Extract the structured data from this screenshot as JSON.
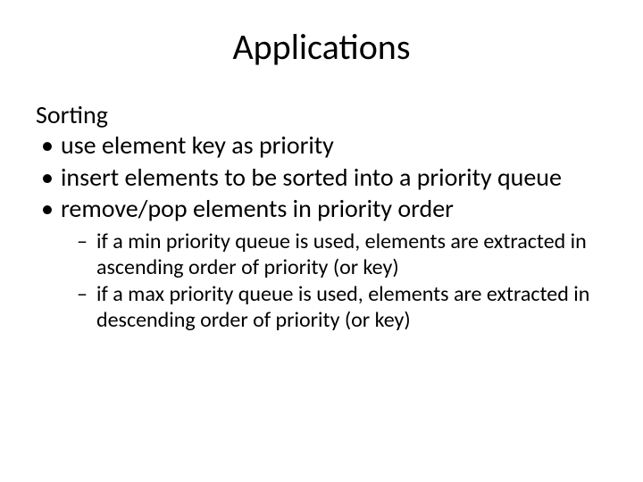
{
  "title": "Applications",
  "section": "Sorting",
  "bullets": [
    "use element key as priority",
    "insert elements to be sorted into a priority queue",
    "remove/pop elements in priority order"
  ],
  "sub_bullets": [
    "if a min priority queue is used, elements are extracted in ascending order of priority (or key)",
    "if a max priority queue is used, elements are extracted in descending order of priority (or key)"
  ]
}
